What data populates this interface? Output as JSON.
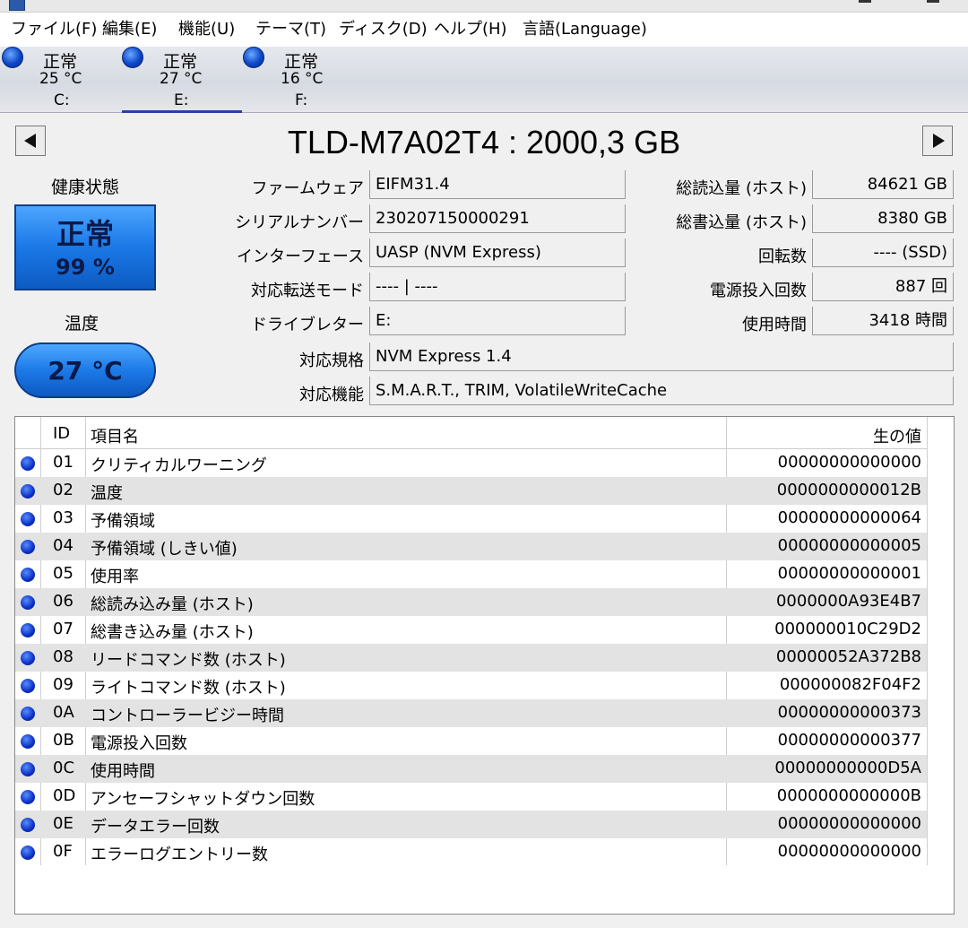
{
  "menu": [
    "ファイル(F)",
    "編集(E)",
    "機能(U)",
    "テーマ(T)",
    "ディスク(D)",
    "ヘルプ(H)",
    "言語(Language)"
  ],
  "disks": [
    {
      "status": "正常",
      "temp": "25 °C",
      "letter": "C:"
    },
    {
      "status": "正常",
      "temp": "27 °C",
      "letter": "E:"
    },
    {
      "status": "正常",
      "temp": "16 °C",
      "letter": "F:"
    }
  ],
  "model": "TLD-M7A02T4 : 2000,3 GB",
  "health": {
    "label": "健康状態",
    "status": "正常",
    "percent": "99 %"
  },
  "temperature": {
    "label": "温度",
    "value": "27 °C"
  },
  "info": {
    "firmware": {
      "label": "ファームウェア",
      "value": "EIFM31.4"
    },
    "serial": {
      "label": "シリアルナンバー",
      "value": "230207150000291"
    },
    "interface": {
      "label": "インターフェース",
      "value": "UASP (NVM Express)"
    },
    "transfer": {
      "label": "対応転送モード",
      "value": "---- | ----"
    },
    "drive_letter": {
      "label": "ドライブレター",
      "value": "E:"
    },
    "standard": {
      "label": "対応規格",
      "value": "NVM Express 1.4"
    },
    "features": {
      "label": "対応機能",
      "value": "S.M.A.R.T., TRIM, VolatileWriteCache"
    },
    "total_read": {
      "label": "総読込量 (ホスト)",
      "value": "84621 GB"
    },
    "total_write": {
      "label": "総書込量 (ホスト)",
      "value": "8380 GB"
    },
    "rotation": {
      "label": "回転数",
      "value": "---- (SSD)"
    },
    "power_count": {
      "label": "電源投入回数",
      "value": "887 回"
    },
    "power_hours": {
      "label": "使用時間",
      "value": "3418 時間"
    }
  },
  "smart": {
    "headers": {
      "id": "ID",
      "name": "項目名",
      "raw": "生の値"
    },
    "rows": [
      {
        "id": "01",
        "name": "クリティカルワーニング",
        "raw": "00000000000000"
      },
      {
        "id": "02",
        "name": "温度",
        "raw": "0000000000012B"
      },
      {
        "id": "03",
        "name": "予備領域",
        "raw": "00000000000064"
      },
      {
        "id": "04",
        "name": "予備領域 (しきい値)",
        "raw": "00000000000005"
      },
      {
        "id": "05",
        "name": "使用率",
        "raw": "00000000000001"
      },
      {
        "id": "06",
        "name": "総読み込み量 (ホスト)",
        "raw": "0000000A93E4B7"
      },
      {
        "id": "07",
        "name": "総書き込み量 (ホスト)",
        "raw": "000000010C29D2"
      },
      {
        "id": "08",
        "name": "リードコマンド数 (ホスト)",
        "raw": "00000052A372B8"
      },
      {
        "id": "09",
        "name": "ライトコマンド数 (ホスト)",
        "raw": "000000082F04F2"
      },
      {
        "id": "0A",
        "name": "コントローラービジー時間",
        "raw": "00000000000373"
      },
      {
        "id": "0B",
        "name": "電源投入回数",
        "raw": "00000000000377"
      },
      {
        "id": "0C",
        "name": "使用時間",
        "raw": "00000000000D5A"
      },
      {
        "id": "0D",
        "name": "アンセーフシャットダウン回数",
        "raw": "0000000000000B"
      },
      {
        "id": "0E",
        "name": "データエラー回数",
        "raw": "00000000000000"
      },
      {
        "id": "0F",
        "name": "エラーログエントリー数",
        "raw": "00000000000000"
      }
    ]
  }
}
